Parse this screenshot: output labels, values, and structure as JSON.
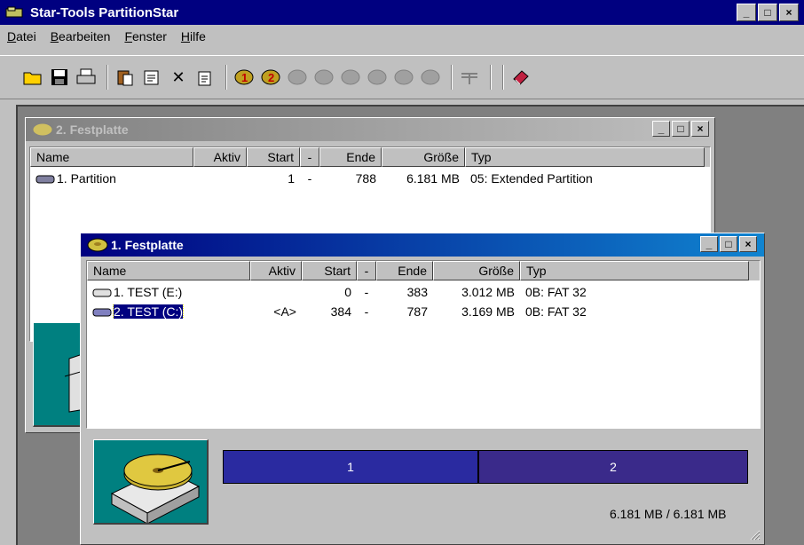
{
  "app": {
    "title": "Star-Tools PartitionStar",
    "window_buttons": [
      "_",
      "□",
      "×"
    ]
  },
  "menu": {
    "items": [
      {
        "label": "Datei",
        "accel": "D",
        "rest": "atei"
      },
      {
        "label": "Bearbeiten",
        "accel": "B",
        "rest": "earbeiten"
      },
      {
        "label": "Fenster",
        "accel": "F",
        "rest": "enster"
      },
      {
        "label": "Hilfe",
        "accel": "H",
        "rest": "ilfe"
      }
    ]
  },
  "toolbar": {
    "icons": [
      "open-folder-icon",
      "save-icon",
      "print-icon",
      "paste-icon",
      "properties-icon",
      "delete-icon",
      "new-document-icon",
      "partition-1-icon",
      "partition-2-icon",
      "partition-3-icon",
      "partition-4-icon",
      "partition-5-icon",
      "partition-6-icon",
      "partition-7-icon",
      "partition-8-icon",
      "split-icon",
      "help-book-icon"
    ]
  },
  "disk2": {
    "title": "2. Festplatte",
    "columns": [
      "Name",
      "Aktiv",
      "Start",
      "-",
      "Ende",
      "Größe",
      "Typ"
    ],
    "rows": [
      {
        "name": "1. Partition",
        "aktiv": "",
        "start": "1",
        "dash": "-",
        "ende": "788",
        "groesse": "6.181 MB",
        "typ": "05: Extended Partition"
      }
    ]
  },
  "disk1": {
    "title": "1. Festplatte",
    "columns": [
      "Name",
      "Aktiv",
      "Start",
      "-",
      "Ende",
      "Größe",
      "Typ"
    ],
    "rows": [
      {
        "name": "1. TEST (E:)",
        "aktiv": "",
        "start": "0",
        "dash": "-",
        "ende": "383",
        "groesse": "3.012 MB",
        "typ": "0B: FAT 32"
      },
      {
        "name": "2. TEST (C:)",
        "aktiv": "<A>",
        "start": "384",
        "dash": "-",
        "ende": "787",
        "groesse": "3.169 MB",
        "typ": "0B: FAT 32"
      }
    ],
    "bar_segments": [
      {
        "label": "1",
        "color": "#2a2aa0",
        "share": 0.487
      },
      {
        "label": "2",
        "color": "#3a2a8a",
        "share": 0.513
      }
    ],
    "size_summary": "6.181 MB / 6.181 MB"
  },
  "colors": {
    "titlebar_active": "#000080",
    "mdi_background": "#808080",
    "face": "#c0c0c0"
  }
}
